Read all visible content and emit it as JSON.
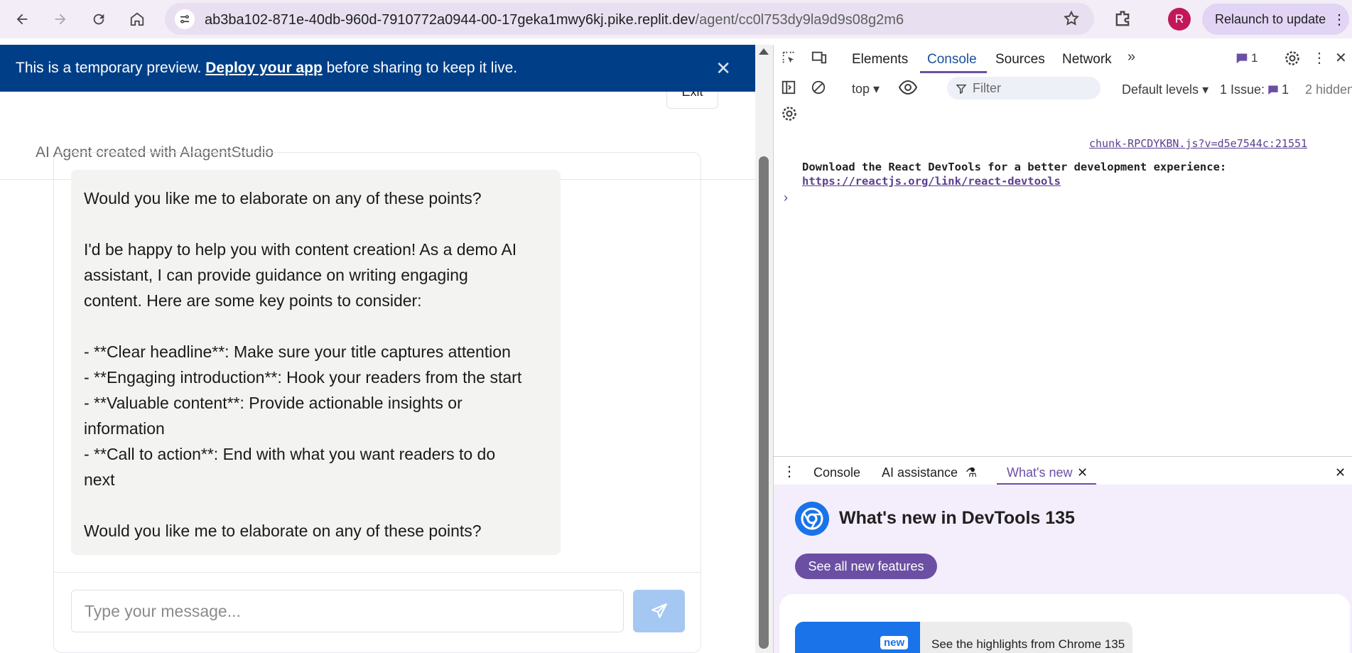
{
  "browser": {
    "url_main": "ab3ba102-871e-40db-960d-7910772a0944-00-17geka1mwy6kj.pike.replit.dev",
    "url_path": "/agent/cc0l753dy9la9d9s08g2m6",
    "profile_initial": "R",
    "relaunch_label": "Relaunch to update"
  },
  "banner": {
    "prefix": "This is a temporary preview. ",
    "link": "Deploy your app",
    "suffix": " before sharing to keep it live.",
    "close_glyph": "✕"
  },
  "header": {
    "exit_label": "Exit",
    "subtitle": "AI Agent created with AIagentStudio"
  },
  "chat": {
    "message": "Would you like me to elaborate on any of these points?\n\nI'd be happy to help you with content creation! As a demo AI\nassistant, I can provide guidance on writing engaging\ncontent. Here are some key points to consider:\n\n- **Clear headline**: Make sure your title captures attention\n- **Engaging introduction**: Hook your readers from the start\n- **Valuable content**: Provide actionable insights or\ninformation\n- **Call to action**: End with what you want readers to do\nnext\n\nWould you like me to elaborate on any of these points?",
    "input_placeholder": "Type your message..."
  },
  "devtools": {
    "tabs": [
      "Elements",
      "Console",
      "Sources",
      "Network"
    ],
    "active_tab": "Console",
    "message_count": "1",
    "context": "top",
    "filter_placeholder": "Filter",
    "levels": "Default levels",
    "issues_label": "1 Issue:",
    "issues_count": "1",
    "hidden": "2 hidden",
    "source_link": "chunk-RPCDYKBN.js?v=d5e7544c:21551",
    "console_message": "Download the React DevTools for a better development experience:",
    "console_url": "https://reactjs.org/link/react-devtools",
    "drawer_tabs": [
      "Console",
      "AI assistance",
      "What's new"
    ],
    "whatsnew_title": "What's new in DevTools 135",
    "whatsnew_button": "See all new features",
    "highlight_badge": "new",
    "highlight_text": "See the highlights from Chrome 135"
  },
  "colors": {
    "banner_bg": "#003f87",
    "send_button": "#a5c8f3",
    "devtools_accent": "#6b4fa6"
  }
}
